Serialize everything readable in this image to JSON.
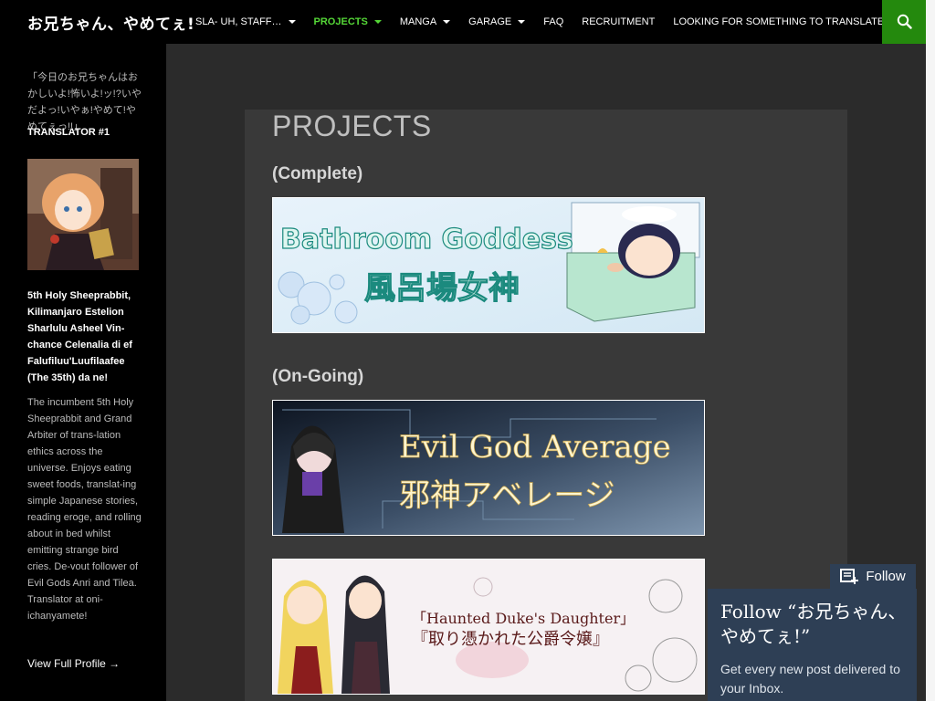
{
  "site": {
    "title": "お兄ちゃん、やめてぇ!"
  },
  "nav": [
    {
      "label": "SLA- UH, STAFF…",
      "caret": true,
      "active": false
    },
    {
      "label": "PROJECTS",
      "caret": true,
      "active": true
    },
    {
      "label": "MANGA",
      "caret": true,
      "active": false
    },
    {
      "label": "GARAGE",
      "caret": true,
      "active": false
    },
    {
      "label": "FAQ",
      "caret": false,
      "active": false
    },
    {
      "label": "RECRUITMENT",
      "caret": false,
      "active": false
    },
    {
      "label": "LOOKING FOR SOMETHING TO TRANSLATE?",
      "caret": false,
      "active": false
    }
  ],
  "sidebar": {
    "tagline": "「今日のお兄ちゃんはおかしいよ!怖いよ!ッ!?いやだよっ!いやぁ!やめて!やめてぇっ!!」",
    "widget_title": "TRANSLATOR #1",
    "profile_name": "5th Holy Sheeprabbit, Kilimanjaro Estelion Sharlulu Asheel Vin-chance Celenalia di ef Falufiluu'Luufilaafee (The 35th) da ne!",
    "profile_bio": "The incumbent 5th Holy Sheeprabbit and Grand Arbiter of trans-lation ethics across the universe. Enjoys eating sweet foods, translat-ing simple Japanese stories, reading eroge, and rolling about in bed whilst emitting strange bird cries. De-vout follower of Evil Gods Anri and Tilea. Translator at oni-ichanyamete!",
    "profile_link": "View Full Profile →"
  },
  "main": {
    "page_title": "PROJECTS",
    "sections": [
      {
        "heading": "(Complete)"
      },
      {
        "heading": "(On-Going)"
      }
    ],
    "banners": [
      {
        "title_en": "Bathroom Goddess",
        "title_jp": "風呂場女神"
      },
      {
        "title_en": "Evil God Average",
        "title_jp": "邪神アベレージ"
      },
      {
        "title_en": "「Haunted Duke's Daughter」",
        "title_jp": "『取り憑かれた公爵令嬢』"
      }
    ]
  },
  "follow": {
    "tab_label": "Follow",
    "heading": "Follow “お兄ちゃん、やめてぇ!”",
    "text": "Get every new post delivered to your Inbox."
  },
  "colors": {
    "nav_active": "#55d737",
    "search_bg": "#24890d",
    "follow_bg": "#2e3f55"
  },
  "icons": [
    "search-icon",
    "follow-icon",
    "caret-down-icon"
  ]
}
